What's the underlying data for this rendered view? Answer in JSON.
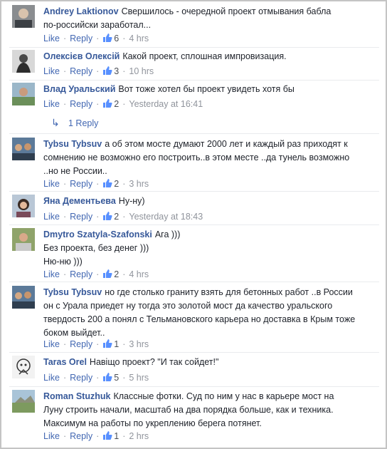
{
  "ui": {
    "like_label": "Like",
    "reply_label": "Reply"
  },
  "comments": [
    {
      "author": "Andrey Laktionov",
      "lines": [
        "Свершилось - очередной проект отмывания бабла",
        "по-российски заработал..."
      ],
      "likes": "6",
      "time": "4 hrs",
      "avatar": "person-avatar-gray"
    },
    {
      "author": "Олексієв Олексій",
      "lines": [
        "Какой проект, сплошная импровизация."
      ],
      "likes": "3",
      "time": "10 hrs",
      "avatar": "person-avatar-bw"
    },
    {
      "author": "Влад Уральский",
      "lines": [
        "Вот тоже хотел бы проект увидеть хотя бы"
      ],
      "likes": "2",
      "time": "Yesterday at 16:41",
      "avatar": "person-avatar-outdoor",
      "replies_label": "1 Reply"
    },
    {
      "author": "Tybsu Tybsuv",
      "lines": [
        "а об этом мосте думают 2000 лет и каждый раз приходят к",
        "сомнению не возможно его построить..в этом месте ..да тунель возможно",
        "..но не России.."
      ],
      "likes": "2",
      "time": "3 hrs",
      "avatar": "group-avatar"
    },
    {
      "author": "Яна Дементьева",
      "lines": [
        "Ну-ну)"
      ],
      "likes": "2",
      "time": "Yesterday at 18:43",
      "avatar": "woman-avatar"
    },
    {
      "author": "Dmytro Szatyla-Szafonski",
      "lines": [
        "Ага )))",
        "Без проекта, без денег )))",
        "Ню-ню )))"
      ],
      "likes": "2",
      "time": "4 hrs",
      "avatar": "man-avatar"
    },
    {
      "author": "Tybsu Tybsuv",
      "lines": [
        "но где столько граниту взять для бетонных работ ..в России",
        "он с Урала приедет ну тогда это золотой мост да качество уральского",
        "твердость 200 а понял с Тельмановского карьера но доставка в Крым тоже",
        "боком выйдет.."
      ],
      "likes": "1",
      "time": "3 hrs",
      "avatar": "group-avatar"
    },
    {
      "author": "Taras Orel",
      "lines": [
        "Навіщо проект? \"И так сойдет!\""
      ],
      "likes": "5",
      "time": "5 hrs",
      "avatar": "drawing-avatar"
    },
    {
      "author": "Roman Stuzhuk",
      "lines": [
        "Классные фотки. Суд по ним у нас в карьере мост на",
        "Луну строить начали, масштаб на два порядка больше, как и техника.",
        "Максимум на работы по укреплению берега потянет."
      ],
      "likes": "1",
      "time": "2 hrs",
      "avatar": "landscape-avatar"
    }
  ]
}
